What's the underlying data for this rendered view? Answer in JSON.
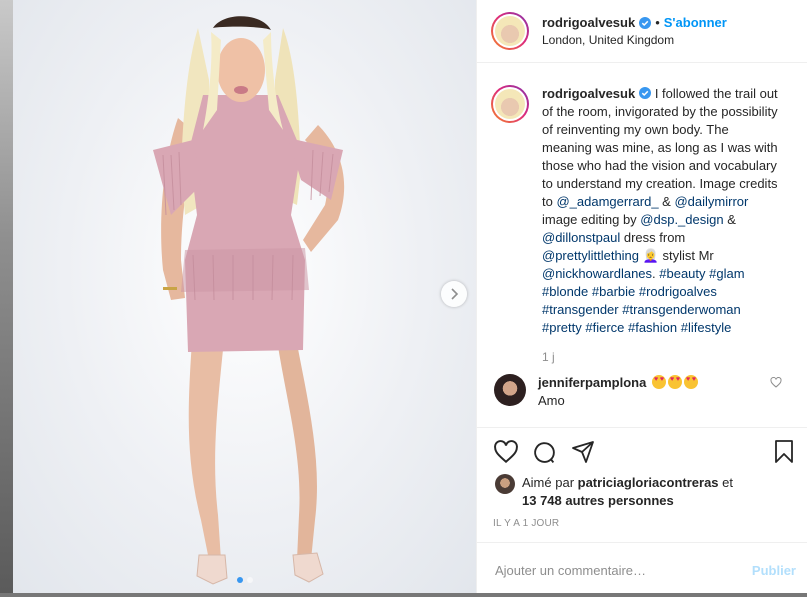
{
  "header": {
    "username": "rodrigoalvesuk",
    "separator": "•",
    "follow_label": "S'abonner",
    "location": "London, United Kingdom"
  },
  "caption": {
    "username": "rodrigoalvesuk",
    "text_1": " I followed the trail out of the room, invigorated by the possibility of reinventing my own body. The meaning was mine, as long as I was with those who had the vision and vocabulary to understand my creation. Image credits to ",
    "mention_1": "@_adamgerrard_",
    "text_2": " & ",
    "mention_2": "@dailymirror",
    "text_3": " image editing by ",
    "mention_3": "@dsp._design",
    "text_4": " & ",
    "mention_4": "@dillonstpaul",
    "text_5": " dress from ",
    "mention_5": "@prettylittlething",
    "emoji_1": "👩‍🦳",
    "text_6": " stylist Mr ",
    "mention_6": "@nickhowardlanes",
    "text_7": ". ",
    "hashtags_1": "#beauty #glam",
    "hashtags_2": "#blonde #barbie #rodrigoalves",
    "hashtags_3": "#transgender #transgenderwoman",
    "hashtags_4": "#pretty #fierce #fashion #lifestyle",
    "time": "1 j"
  },
  "reply": {
    "username": "jenniferpamplona",
    "text_partial": "Amo"
  },
  "likes": {
    "prefix": "Aimé par ",
    "liker": "patriciagloriacontreras",
    "middle": " et",
    "others": "13 748 autres personnes"
  },
  "timestamp": "IL Y A 1 JOUR",
  "comment_box": {
    "placeholder": "Ajouter un commentaire…",
    "publish_label": "Publier"
  },
  "carousel": {
    "slide_count": 2,
    "active_index": 0
  },
  "colors": {
    "link": "#0095f6",
    "mention": "#00376b",
    "verified": "#3897f0",
    "muted": "#8e8e8e",
    "dress": "#d9a7b4"
  },
  "icons": [
    "verified-icon",
    "chevron-right-icon",
    "heart-icon",
    "comment-icon",
    "share-icon",
    "bookmark-icon",
    "small-heart-icon",
    "heart-eyes-emoji"
  ]
}
